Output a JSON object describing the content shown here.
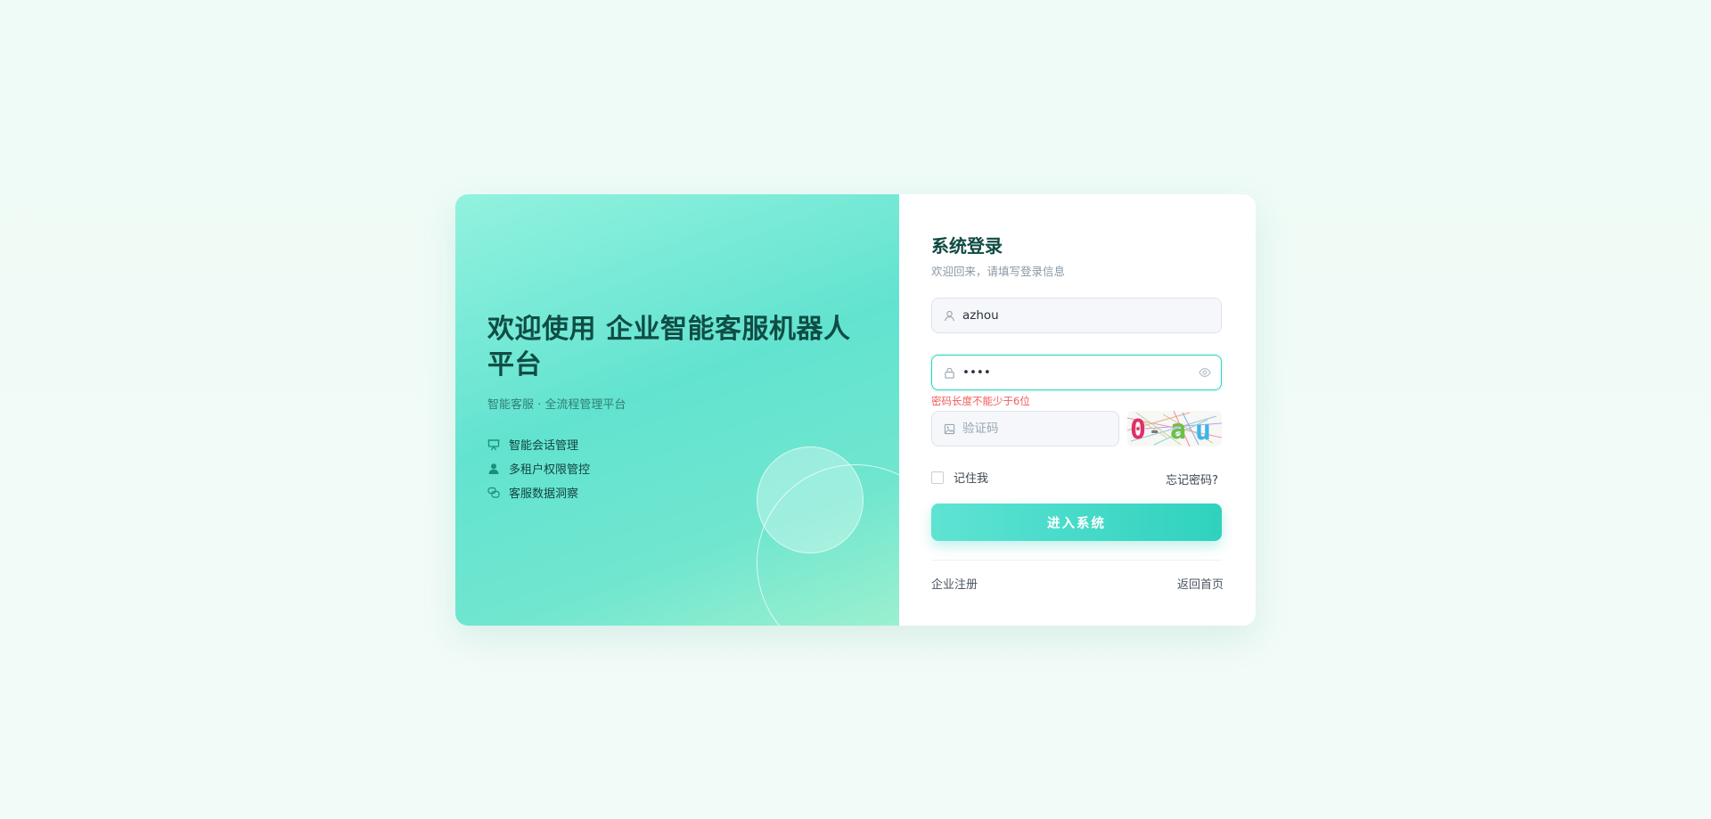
{
  "hero": {
    "title": "欢迎使用 企业智能客服机器人平台",
    "subtitle": "智能客服 · 全流程管理平台",
    "features": [
      {
        "icon": "chalkboard-icon",
        "label": "智能会话管理"
      },
      {
        "icon": "user-icon",
        "label": "多租户权限管控"
      },
      {
        "icon": "chat-bubbles-icon",
        "label": "客服数据洞察"
      }
    ]
  },
  "login": {
    "title": "系统登录",
    "subtitle": "欢迎回来，请填写登录信息",
    "username": {
      "value": "azhou",
      "icon": "user-icon"
    },
    "password": {
      "value": "••••",
      "icon": "lock-icon",
      "toggle_icon": "eye-icon"
    },
    "password_error": "密码长度不能少于6位",
    "captcha": {
      "placeholder": "验证码",
      "icon": "image-icon",
      "code_text": "0-au"
    },
    "remember_label": "记住我",
    "forgot_label": "忘记密码?",
    "submit_label": "进入系统",
    "register_label": "企业注册",
    "home_label": "返回首页"
  },
  "colors": {
    "accent": "#2fd2be",
    "error": "#f15b5b",
    "title": "#0e4a42"
  }
}
